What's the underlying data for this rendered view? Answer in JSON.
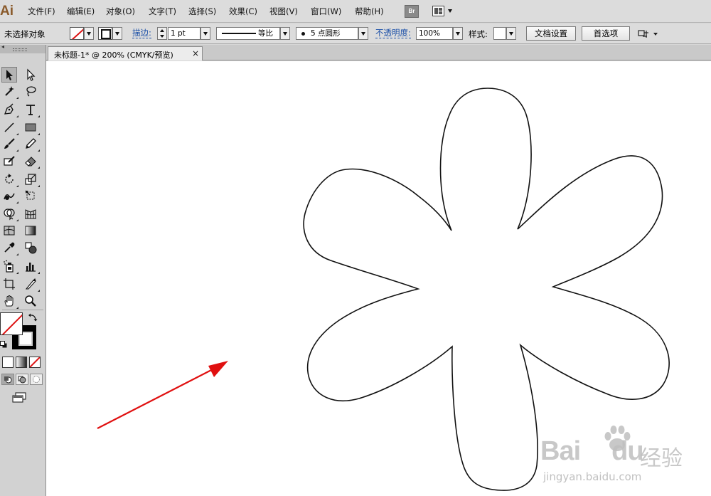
{
  "app": {
    "logo_text": "Ai"
  },
  "menu": {
    "items": [
      "文件(F)",
      "编辑(E)",
      "对象(O)",
      "文字(T)",
      "选择(S)",
      "效果(C)",
      "视图(V)",
      "窗口(W)",
      "帮助(H)"
    ],
    "bridge_label": "Br",
    "arrange_icon": "arrange-documents-icon"
  },
  "control_bar": {
    "selection_status": "未选择对象",
    "stroke_label": "描边:",
    "stroke_weight": "1 pt",
    "stroke_profile": "等比",
    "brush_label": "5 点圆形",
    "opacity_label": "不透明度:",
    "opacity_value": "100%",
    "style_label": "样式:",
    "doc_setup_button": "文档设置",
    "preferences_button": "首选项"
  },
  "document": {
    "tab_title": "未标题-1* @ 200% (CMYK/预览)",
    "close_glyph": "×"
  },
  "tools": [
    "selection-tool",
    "direct-selection-tool",
    "magic-wand-tool",
    "lasso-tool",
    "pen-tool",
    "type-tool",
    "line-segment-tool",
    "rectangle-tool",
    "paintbrush-tool",
    "pencil-tool",
    "blob-brush-tool",
    "eraser-tool",
    "rotate-tool",
    "scale-tool",
    "warp-tool",
    "free-transform-tool",
    "shape-builder-tool",
    "perspective-grid-tool",
    "mesh-tool",
    "gradient-tool",
    "eyedropper-tool",
    "blend-tool",
    "symbol-sprayer-tool",
    "column-graph-tool",
    "artboard-tool",
    "slice-tool",
    "hand-tool",
    "zoom-tool"
  ],
  "colors": {
    "fill": "none",
    "stroke": "#000000",
    "none_slash": "#dd1111",
    "annotation_arrow": "#e01010",
    "shape_stroke": "#111111",
    "logo": "#8a5a2b"
  },
  "canvas": {
    "zoom_percent": 200,
    "color_mode": "CMYK",
    "shape": "flower-6-petal-outline"
  },
  "watermark": {
    "logo": "Bai",
    "logo2": "du",
    "text_cn": "经验",
    "url": "jingyan.baidu.com"
  }
}
